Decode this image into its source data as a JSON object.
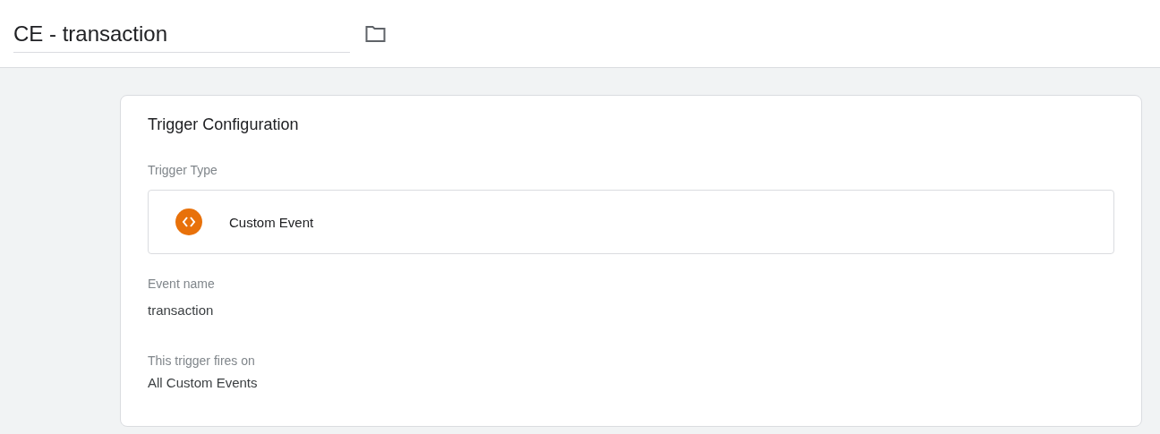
{
  "header": {
    "name_value": "CE - transaction"
  },
  "card": {
    "title": "Trigger Configuration",
    "trigger_type": {
      "label": "Trigger Type",
      "value": "Custom Event"
    },
    "fields": [
      {
        "label": "Event name",
        "value": "transaction"
      },
      {
        "label": "This trigger fires on",
        "value": "All Custom Events"
      }
    ]
  }
}
